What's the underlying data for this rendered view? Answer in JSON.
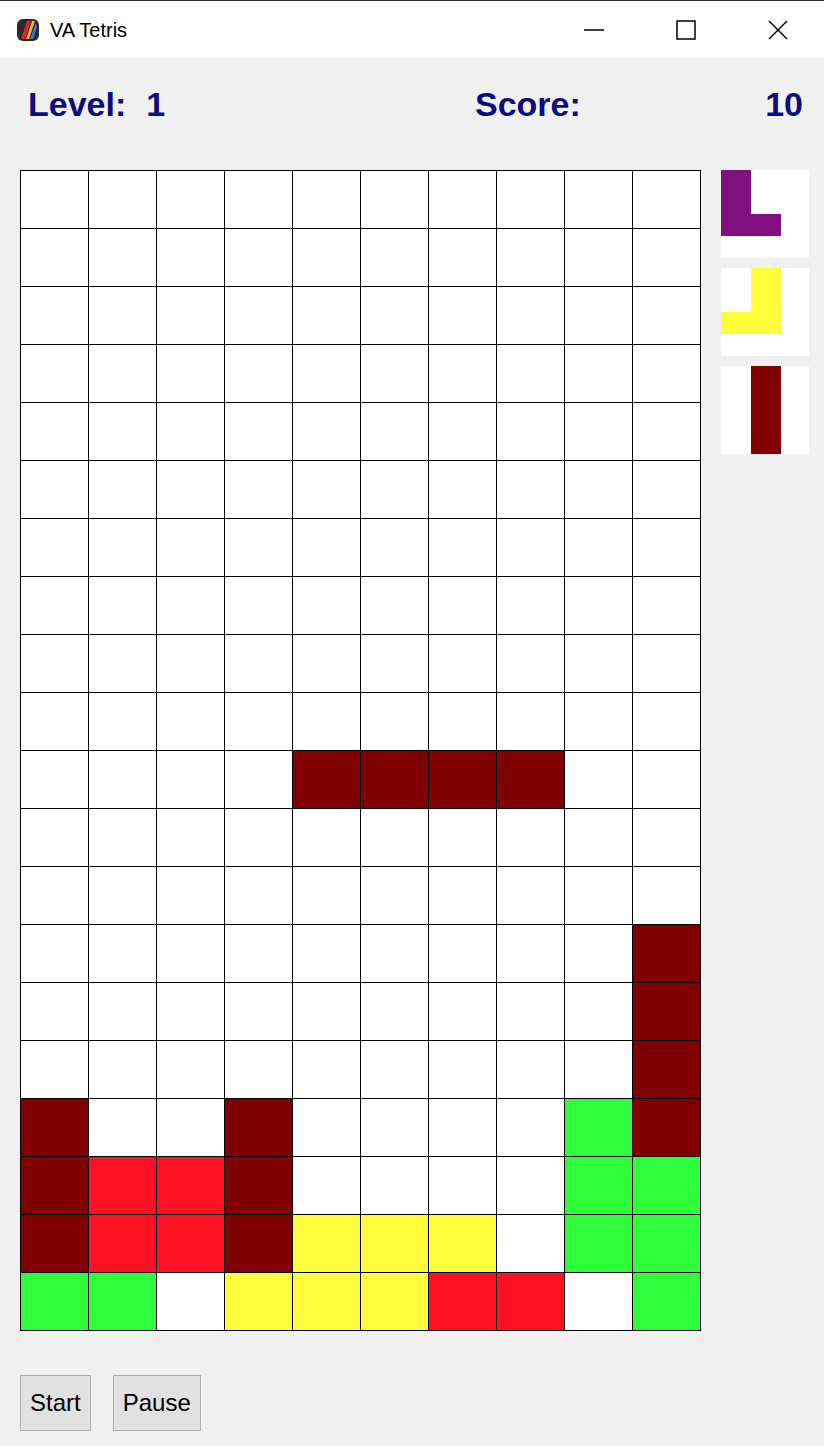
{
  "window": {
    "title": "VA Tetris"
  },
  "header": {
    "level_label": "Level:",
    "level": "1",
    "score_label": "Score:",
    "score": "10"
  },
  "board": {
    "rows": [
      [
        "",
        "",
        "",
        "",
        "",
        "",
        "",
        "",
        "",
        ""
      ],
      [
        "",
        "",
        "",
        "",
        "",
        "",
        "",
        "",
        "",
        ""
      ],
      [
        "",
        "",
        "",
        "",
        "",
        "",
        "",
        "",
        "",
        ""
      ],
      [
        "",
        "",
        "",
        "",
        "",
        "",
        "",
        "",
        "",
        ""
      ],
      [
        "",
        "",
        "",
        "",
        "",
        "",
        "",
        "",
        "",
        ""
      ],
      [
        "",
        "",
        "",
        "",
        "",
        "",
        "",
        "",
        "",
        ""
      ],
      [
        "",
        "",
        "",
        "",
        "",
        "",
        "",
        "",
        "",
        ""
      ],
      [
        "",
        "",
        "",
        "",
        "",
        "",
        "",
        "",
        "",
        ""
      ],
      [
        "",
        "",
        "",
        "",
        "",
        "",
        "",
        "",
        "",
        ""
      ],
      [
        "",
        "",
        "",
        "",
        "",
        "",
        "",
        "",
        "",
        ""
      ],
      [
        "",
        "",
        "",
        "",
        "#800000",
        "#800000",
        "#800000",
        "#800000",
        "",
        ""
      ],
      [
        "",
        "",
        "",
        "",
        "",
        "",
        "",
        "",
        "",
        ""
      ],
      [
        "",
        "",
        "",
        "",
        "",
        "",
        "",
        "",
        "",
        ""
      ],
      [
        "",
        "",
        "",
        "",
        "",
        "",
        "",
        "",
        "",
        "#800000"
      ],
      [
        "",
        "",
        "",
        "",
        "",
        "",
        "",
        "",
        "",
        "#800000"
      ],
      [
        "",
        "",
        "",
        "",
        "",
        "",
        "",
        "",
        "",
        "#800000"
      ],
      [
        "#800000",
        "",
        "",
        "#800000",
        "",
        "",
        "",
        "",
        "#2dfd3b",
        "#800000"
      ],
      [
        "#800000",
        "#fd1123",
        "#fd1123",
        "#800000",
        "",
        "",
        "",
        "",
        "#2dfd3b",
        "#2dfd3b"
      ],
      [
        "#800000",
        "#fd1123",
        "#fd1123",
        "#800000",
        "#fdfd3a",
        "#fdfd3a",
        "#fdfd3a",
        "",
        "#2dfd3b",
        "#2dfd3b"
      ],
      [
        "#2dfd3b",
        "#2dfd3b",
        "",
        "#fdfd3a",
        "#fdfd3a",
        "#fdfd3a",
        "#fd1123",
        "#fd1123",
        "",
        "#2dfd3b"
      ]
    ]
  },
  "next_pieces": [
    {
      "color": "#801080",
      "cells": [
        [
          1,
          0,
          0
        ],
        [
          1,
          0,
          0
        ],
        [
          1,
          1,
          0
        ],
        [
          0,
          0,
          0
        ]
      ]
    },
    {
      "color": "#fdfd3a",
      "cells": [
        [
          0,
          1,
          0
        ],
        [
          0,
          1,
          0
        ],
        [
          1,
          1,
          0
        ],
        [
          0,
          0,
          0
        ]
      ]
    },
    {
      "color": "#800000",
      "cells": [
        [
          0,
          1,
          0
        ],
        [
          0,
          1,
          0
        ],
        [
          0,
          1,
          0
        ],
        [
          0,
          1,
          0
        ]
      ]
    }
  ],
  "buttons": [
    "Start",
    "Pause"
  ]
}
